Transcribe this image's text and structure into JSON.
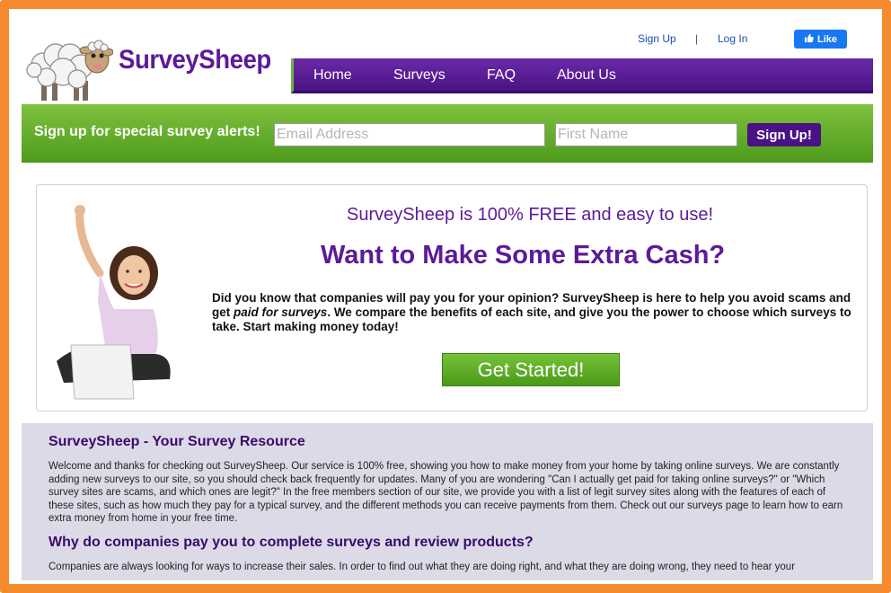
{
  "colors": {
    "frame": "#f58a2e",
    "brand_purple": "#5c1a99",
    "nav_purple": "#4a1284",
    "signup_green": "#5fa82a",
    "resource_bg": "#dcdae7",
    "link_blue": "#1a4fb0"
  },
  "header": {
    "brand": "SurveySheep",
    "logo_icon": "sheep-logo-icon",
    "top_links": {
      "sign_up": "Sign Up",
      "separator": "|",
      "log_in": "Log In"
    },
    "fb_like": "Like",
    "nav": [
      "Home",
      "Surveys",
      "FAQ",
      "About Us"
    ]
  },
  "signup_bar": {
    "label": "Sign up for special survey alerts!",
    "email_placeholder": "Email Address",
    "name_placeholder": "First Name",
    "button": "Sign Up!"
  },
  "hero": {
    "subtitle": "SurveySheep is 100% FREE and easy to use!",
    "title": "Want to Make Some Extra Cash?",
    "text_before": "Did you know that companies will pay you for your opinion? SurveySheep is here to help you avoid scams and get ",
    "text_emph": "paid for surveys",
    "text_after": ". We compare the benefits of each site, and give you the power to choose which surveys to take. Start making money today!",
    "button": "Get Started!"
  },
  "resource": {
    "heading1": "SurveySheep - Your Survey Resource",
    "para1": "Welcome and thanks for checking out SurveySheep. Our service is 100% free, showing you how to make money from your home by taking online surveys. We are constantly adding new surveys to our site, so you should check back frequently for updates. Many of you are wondering \"Can I actually get paid for taking online surveys?\" or \"Which survey sites are scams, and which ones are legit?\" In the free members section of our site, we provide you with a list of legit survey sites along with the features of each of these sites, such as how much they pay for a typical survey, and the different methods you can receive payments from them. Check out our surveys page to learn how to earn extra money from home in your free time.",
    "heading2": "Why do companies pay you to complete surveys and review products?",
    "para2": "Companies are always looking for ways to increase their sales. In order to find out what they are doing right, and what they are doing wrong, they need to hear your"
  }
}
